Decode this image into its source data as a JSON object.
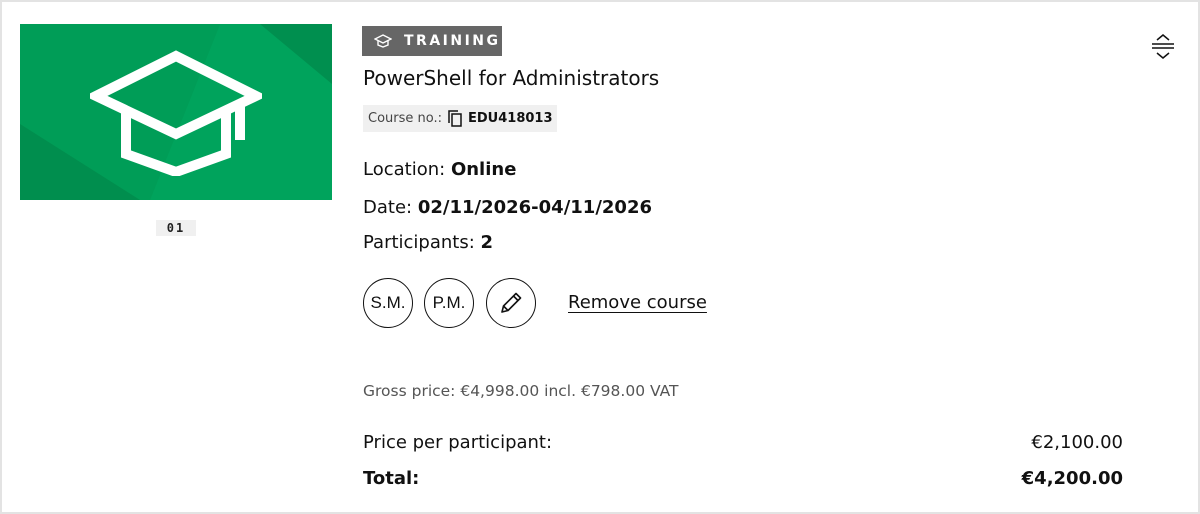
{
  "item": {
    "index": "01",
    "type_badge": "TRAINING",
    "type_icon": "graduation-cap-icon",
    "title": "PowerShell for Administrators",
    "course_no_label": "Course no.:",
    "course_no": "EDU418013",
    "location_label": "Location:",
    "location": "Online",
    "date_label": "Date:",
    "date": "02/11/2026-04/11/2026",
    "participants_label": "Participants:",
    "participants": "2",
    "participant_avatars": [
      "S.M.",
      "P.M."
    ],
    "remove_label": "Remove course",
    "gross_price_text": "Gross price: €4,998.00 incl. €798.00 VAT",
    "price_per_participant_label": "Price per participant:",
    "price_per_participant": "€2,100.00",
    "total_label": "Total:",
    "total": "€4,200.00"
  },
  "colors": {
    "thumbnail_green": "#009655",
    "badge_gray": "#666666"
  }
}
